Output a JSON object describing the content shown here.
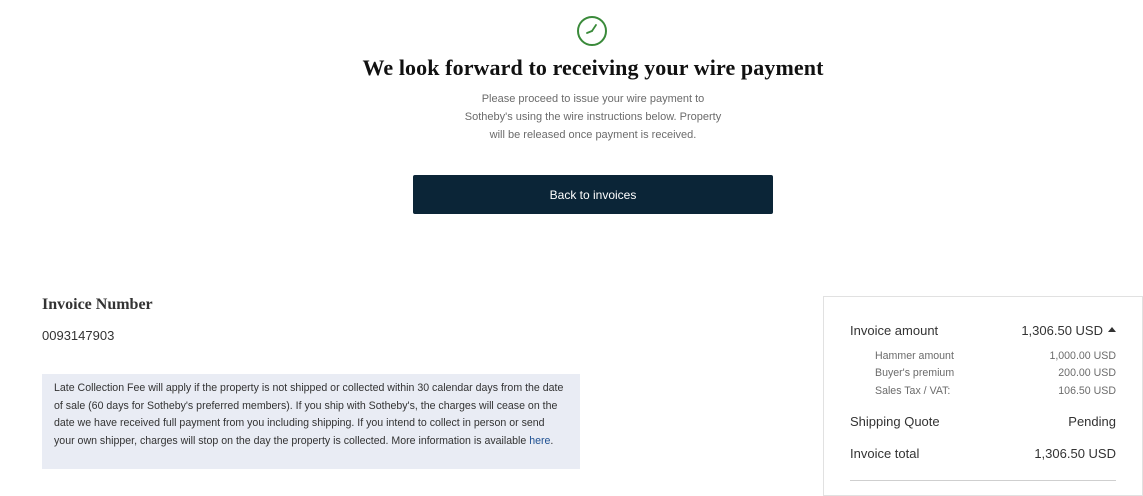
{
  "header": {
    "icon": "clock-icon",
    "accent_color": "#3a8a3a",
    "title": "We look forward to receiving your wire payment",
    "subtitle_line1": "Please proceed to issue your wire payment to",
    "subtitle_line2": "Sotheby's using the wire instructions below. Property",
    "subtitle_line3": "will be released once payment is received."
  },
  "actions": {
    "back_label": "Back to invoices",
    "button_color": "#0b2537"
  },
  "invoice": {
    "number_label": "Invoice Number",
    "number": "0093147903"
  },
  "notice": {
    "text": "Late Collection Fee will apply if the property is not shipped or collected within 30 calendar days from the date of sale (60 days for Sotheby's preferred members). If you ship with Sotheby's, the charges will cease on the date we have received full payment from you including shipping. If you intend to collect in person or send your own shipper, charges will stop on the day the property is collected. More information is available ",
    "link_text": "here",
    "end": "."
  },
  "summary": {
    "invoice_amount_label": "Invoice amount",
    "invoice_amount": "1,306.50 USD",
    "breakdown": [
      {
        "label": "Hammer amount",
        "value": "1,000.00 USD"
      },
      {
        "label": "Buyer's premium",
        "value": "200.00 USD"
      },
      {
        "label": "Sales Tax / VAT:",
        "value": "106.50 USD"
      }
    ],
    "shipping_label": "Shipping Quote",
    "shipping_value": "Pending",
    "total_label": "Invoice total",
    "total_value": "1,306.50 USD"
  }
}
